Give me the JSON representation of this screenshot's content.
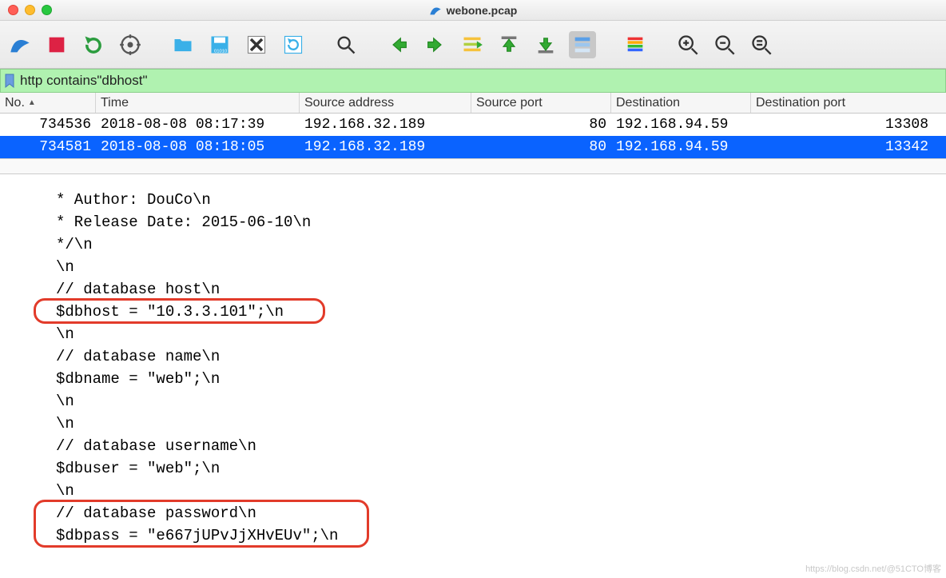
{
  "window": {
    "filename": "webone.pcap"
  },
  "filter": {
    "value": "http contains\"dbhost\""
  },
  "columns": {
    "no": "No.",
    "time": "Time",
    "src": "Source address",
    "sport": "Source port",
    "dest": "Destination",
    "dport": "Destination port"
  },
  "packets": [
    {
      "no": "734536",
      "time": "2018-08-08 08:17:39",
      "src": "192.168.32.189",
      "sport": "80",
      "dest": "192.168.94.59",
      "dport": "13308",
      "selected": false
    },
    {
      "no": "734581",
      "time": "2018-08-08 08:18:05",
      "src": "192.168.32.189",
      "sport": "80",
      "dest": "192.168.94.59",
      "dport": "13342",
      "selected": true
    }
  ],
  "detail": {
    "lines": [
      " * Author: DouCo\\n",
      " * Release Date: 2015-06-10\\n",
      " */\\n",
      "\\n",
      "// database host\\n",
      "$dbhost   = \"10.3.3.101\";\\n",
      "\\n",
      "// database name\\n",
      "$dbname   = \"web\";\\n",
      "\\n",
      "\\n",
      "// database username\\n",
      "$dbuser   = \"web\";\\n",
      "\\n",
      "// database password\\n",
      "$dbpass   = \"e667jUPvJjXHvEUv\";\\n"
    ]
  },
  "watermark": "https://blog.csdn.net/@51CTO博客"
}
